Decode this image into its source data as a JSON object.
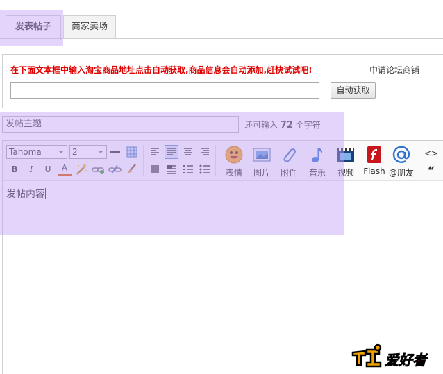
{
  "tabs": [
    {
      "label": "发表帖子",
      "active": true
    },
    {
      "label": "商家卖场",
      "active": false
    }
  ],
  "taobao": {
    "message": "在下面文本框中输入淘宝商品地址点击自动获取,商品信息会自动添加,赶快试试吧!",
    "apply_link": "申请论坛商铺",
    "url_input_value": "",
    "fetch_button": "自动获取"
  },
  "subject": {
    "placeholder": "发帖主题",
    "remaining_prefix": "还可输入",
    "remaining_count": "72",
    "remaining_suffix": "个字符"
  },
  "toolbar": {
    "font_family": "Tahoma",
    "font_size": "2",
    "format_buttons": {
      "bold": "B",
      "italic": "I",
      "underline": "U",
      "font_color": "A"
    },
    "media_buttons": [
      {
        "label": "表情",
        "icon": "smiley-icon"
      },
      {
        "label": "图片",
        "icon": "image-icon"
      },
      {
        "label": "附件",
        "icon": "paperclip-icon"
      },
      {
        "label": "音乐",
        "icon": "music-note-icon"
      },
      {
        "label": "视频",
        "icon": "film-icon"
      },
      {
        "label": "Flash",
        "icon": "flash-icon"
      },
      {
        "label": "@朋友",
        "icon": "at-icon"
      }
    ],
    "code_glyph": "<>",
    "quote_glyph": "“"
  },
  "editor": {
    "content": "发帖内容"
  },
  "watermark": {
    "text": "爱好者"
  },
  "colors": {
    "accent_red": "#e00000",
    "highlight": "#bea0f5",
    "border": "#cfcfcf"
  }
}
